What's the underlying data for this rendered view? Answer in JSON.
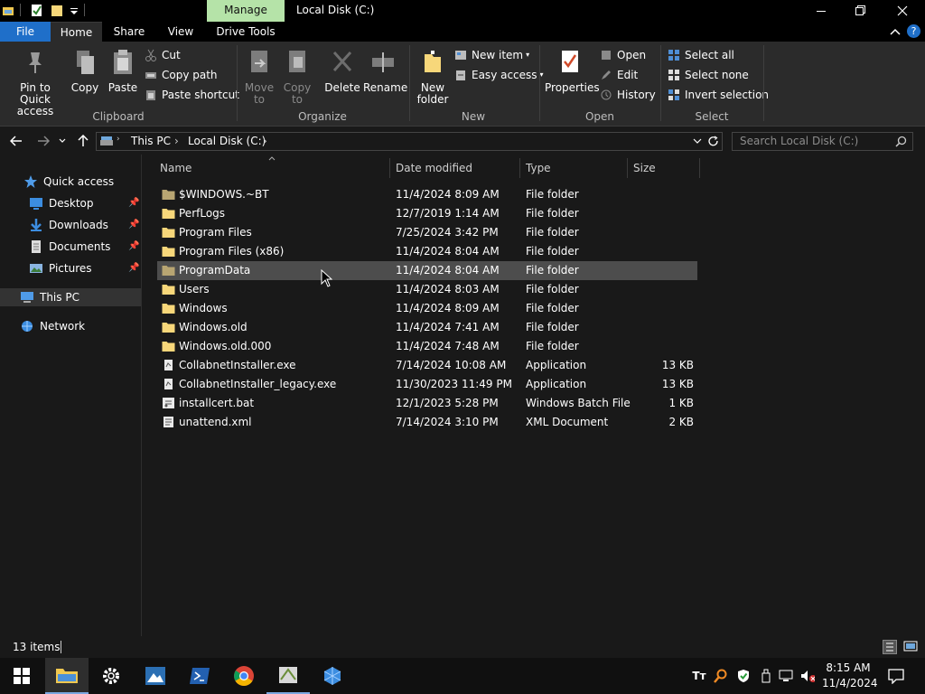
{
  "window": {
    "title": "Local Disk (C:)",
    "contextual_tab": "Manage",
    "contextual_tab_color": "#b5e3a8",
    "controls": [
      "minimize-icon",
      "maximize-icon",
      "close-icon"
    ]
  },
  "ribbon_tabs": [
    "File",
    "Home",
    "Share",
    "View",
    "Drive Tools"
  ],
  "ribbon": {
    "clipboard": {
      "pin": "Pin to Quick access",
      "copy": "Copy",
      "paste": "Paste",
      "cut": "Cut",
      "copy_path": "Copy path",
      "paste_shortcut": "Paste shortcut",
      "label": "Clipboard"
    },
    "organize": {
      "move_to": "Move to",
      "copy_to": "Copy to",
      "delete": "Delete",
      "rename": "Rename",
      "label": "Organize"
    },
    "new": {
      "new_folder": "New folder",
      "new_item": "New item",
      "easy_access": "Easy access",
      "label": "New"
    },
    "open": {
      "properties": "Properties",
      "open": "Open",
      "edit": "Edit",
      "history": "History",
      "label": "Open"
    },
    "select": {
      "select_all": "Select all",
      "select_none": "Select none",
      "invert": "Invert selection",
      "label": "Select"
    }
  },
  "address": {
    "segments": [
      "This PC",
      "Local Disk (C:)"
    ],
    "search_placeholder": "Search Local Disk (C:)"
  },
  "nav": {
    "quick_access": "Quick access",
    "desktop": "Desktop",
    "downloads": "Downloads",
    "documents": "Documents",
    "pictures": "Pictures",
    "this_pc": "This PC",
    "network": "Network"
  },
  "columns": {
    "name": "Name",
    "date": "Date modified",
    "type": "Type",
    "size": "Size"
  },
  "files": [
    {
      "name": "$WINDOWS.~BT",
      "date": "11/4/2024 8:09 AM",
      "type": "File folder",
      "size": "",
      "icon": "folder-hidden"
    },
    {
      "name": "PerfLogs",
      "date": "12/7/2019 1:14 AM",
      "type": "File folder",
      "size": "",
      "icon": "folder"
    },
    {
      "name": "Program Files",
      "date": "7/25/2024 3:42 PM",
      "type": "File folder",
      "size": "",
      "icon": "folder"
    },
    {
      "name": "Program Files (x86)",
      "date": "11/4/2024 8:04 AM",
      "type": "File folder",
      "size": "",
      "icon": "folder"
    },
    {
      "name": "ProgramData",
      "date": "11/4/2024 8:04 AM",
      "type": "File folder",
      "size": "",
      "icon": "folder-hidden"
    },
    {
      "name": "Users",
      "date": "11/4/2024 8:03 AM",
      "type": "File folder",
      "size": "",
      "icon": "folder"
    },
    {
      "name": "Windows",
      "date": "11/4/2024 8:09 AM",
      "type": "File folder",
      "size": "",
      "icon": "folder"
    },
    {
      "name": "Windows.old",
      "date": "11/4/2024 7:41 AM",
      "type": "File folder",
      "size": "",
      "icon": "folder"
    },
    {
      "name": "Windows.old.000",
      "date": "11/4/2024 7:48 AM",
      "type": "File folder",
      "size": "",
      "icon": "folder"
    },
    {
      "name": "CollabnetInstaller.exe",
      "date": "7/14/2024 10:08 AM",
      "type": "Application",
      "size": "13 KB",
      "icon": "exe"
    },
    {
      "name": "CollabnetInstaller_legacy.exe",
      "date": "11/30/2023 11:49 PM",
      "type": "Application",
      "size": "13 KB",
      "icon": "exe"
    },
    {
      "name": "installcert.bat",
      "date": "12/1/2023 5:28 PM",
      "type": "Windows Batch File",
      "size": "1 KB",
      "icon": "bat"
    },
    {
      "name": "unattend.xml",
      "date": "7/14/2024 3:10 PM",
      "type": "XML Document",
      "size": "2 KB",
      "icon": "xml"
    }
  ],
  "status": {
    "count": "13 items"
  },
  "taskbar": {
    "apps": [
      "start-icon",
      "file-explorer-icon",
      "settings-icon",
      "app-icon",
      "powershell-icon",
      "chrome-icon",
      "installer-icon",
      "box-app-icon"
    ],
    "time": "8:15 AM",
    "date": "11/4/2024",
    "tray": [
      "font-icon",
      "search-tool-icon",
      "shield-icon",
      "usb-icon",
      "network-icon",
      "volume-muted-icon",
      "notification-icon"
    ]
  },
  "colors": {
    "accent": "#1f6fc9",
    "folder": "#f7d77a",
    "selection": "#4d4d4d"
  }
}
